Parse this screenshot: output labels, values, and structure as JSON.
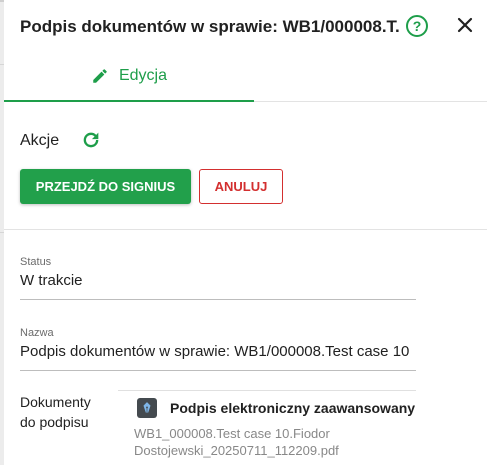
{
  "header": {
    "title": "Podpis dokumentów w sprawie: WB1/000008.T...",
    "help_icon": "help-circle-icon",
    "close_icon": "close-icon"
  },
  "tabs": [
    {
      "label": "Edycja",
      "icon": "pencil-icon",
      "active": true
    }
  ],
  "actions": {
    "label": "Akcje",
    "refresh_icon": "refresh-icon",
    "primary_button": "PRZEJDŹ DO SIGNIUS",
    "cancel_button": "ANULUJ"
  },
  "fields": {
    "status": {
      "label": "Status",
      "value": "W trakcie"
    },
    "name": {
      "label": "Nazwa",
      "value": "Podpis dokumentów w sprawie: WB1/000008.Test case 10"
    }
  },
  "documents": {
    "label": "Dokumenty do podpisu",
    "items": [
      {
        "icon": "fountain-pen-icon",
        "type": "Podpis elektroniczny zaawansowany",
        "file": "WB1_000008.Test case 10.Fiodor Dostojewski_20250711_112209.pdf"
      }
    ]
  },
  "colors": {
    "accent": "#1e9e4a",
    "primary_button": "#22a04b",
    "danger": "#d32f2f"
  }
}
